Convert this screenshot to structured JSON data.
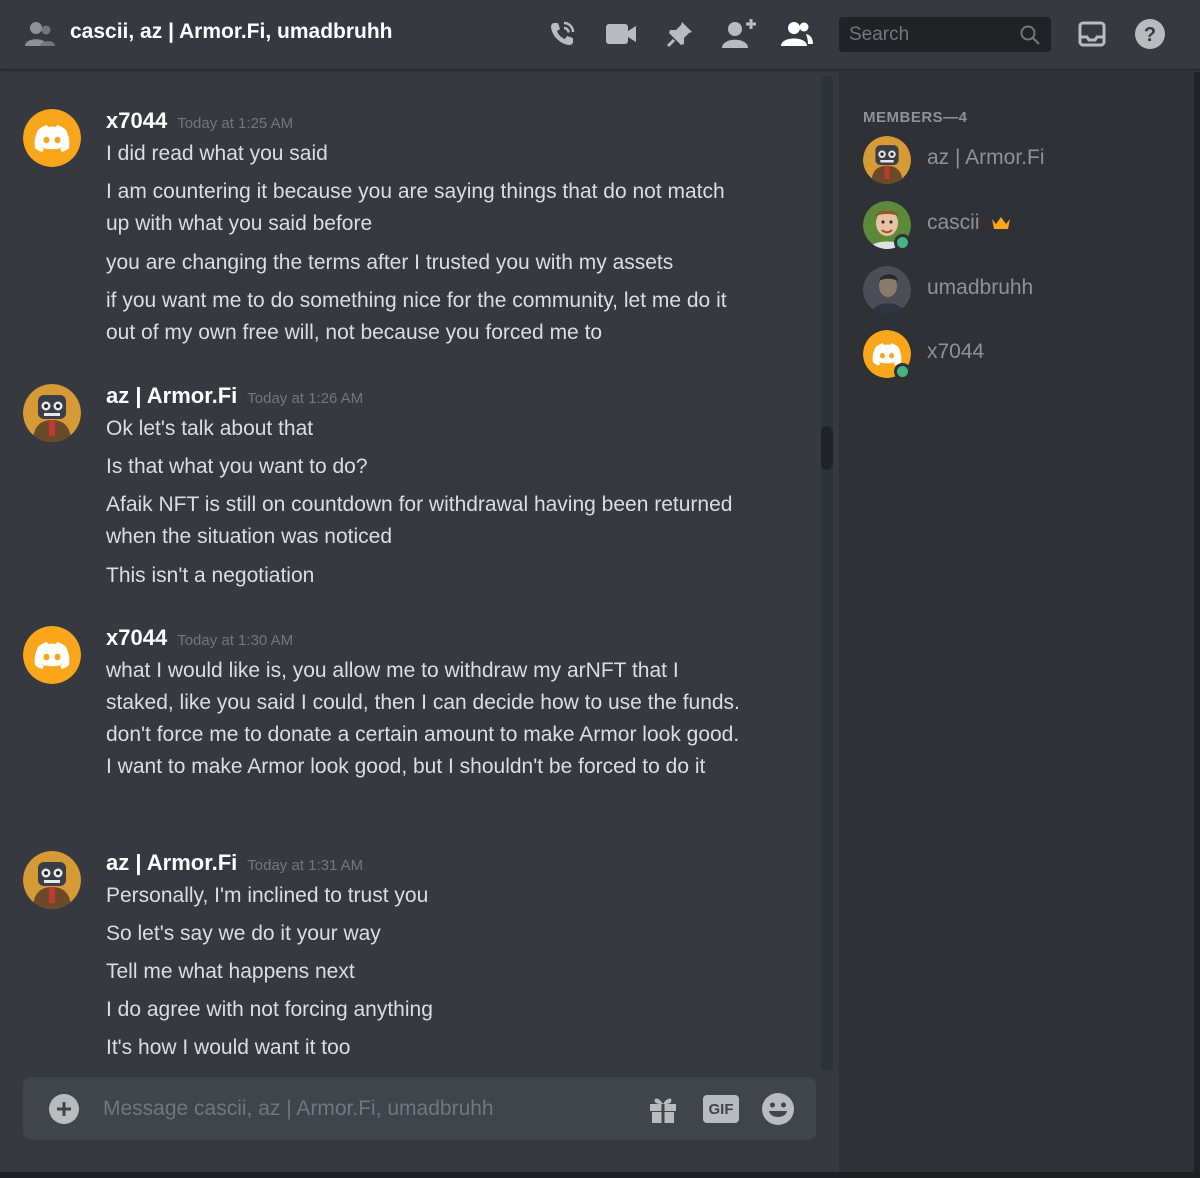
{
  "header": {
    "title": "cascii, az | Armor.Fi, umadbruhh",
    "search_placeholder": "Search"
  },
  "messages": [
    {
      "author": "x7044",
      "timestamp": "Today at 1:25 AM",
      "avatar": "discord-default-yellow",
      "lines": [
        "I did read what you said",
        "I am countering it because you are saying things that do not match up with what you said before",
        "you are changing the terms after I trusted you with my assets",
        "if you want me to do something nice for the community, let me do it out of my own free will, not because you forced me to"
      ]
    },
    {
      "author": "az | Armor.Fi",
      "timestamp": "Today at 1:26 AM",
      "avatar": "robot-avatar",
      "lines": [
        "Ok let's talk about that",
        "Is that what you want to do?",
        "Afaik NFT is still on countdown for withdrawal having been returned when the situation was noticed",
        "This isn't a negotiation"
      ]
    },
    {
      "author": "x7044",
      "timestamp": "Today at 1:30 AM",
      "avatar": "discord-default-yellow",
      "lines": [
        "what I would like is, you allow me to withdraw my arNFT that I staked, like you said I could, then I can decide how to use the funds. don't force me to donate a certain amount to make Armor look good. I want to make Armor look good, but I shouldn't be forced to do it"
      ]
    },
    {
      "author": "az | Armor.Fi",
      "timestamp": "Today at 1:31 AM",
      "avatar": "robot-avatar",
      "lines": [
        "Personally, I'm inclined to trust you",
        "So let's say we do it your way",
        "Tell me what happens next",
        "I do agree with not forcing anything",
        "It's how I would want it too"
      ]
    }
  ],
  "composer": {
    "placeholder": "Message cascii, az | Armor.Fi, umadbruhh",
    "gif_label": "GIF"
  },
  "members": {
    "heading": "MEMBERS—4",
    "list": [
      {
        "name": "az | Armor.Fi",
        "online": false,
        "owner": false,
        "avatar": "robot-avatar"
      },
      {
        "name": "cascii",
        "online": true,
        "owner": true,
        "avatar": "person-photo-avatar"
      },
      {
        "name": "umadbruhh",
        "online": false,
        "owner": false,
        "avatar": "person-dark-avatar"
      },
      {
        "name": "x7044",
        "online": true,
        "owner": false,
        "avatar": "discord-default-yellow"
      }
    ]
  },
  "colors": {
    "chat_bg": "#36393f",
    "sidebar_bg": "#2f3136",
    "online": "#43b581",
    "default_avatar": "#faa61a",
    "crown": "#faa61a"
  }
}
